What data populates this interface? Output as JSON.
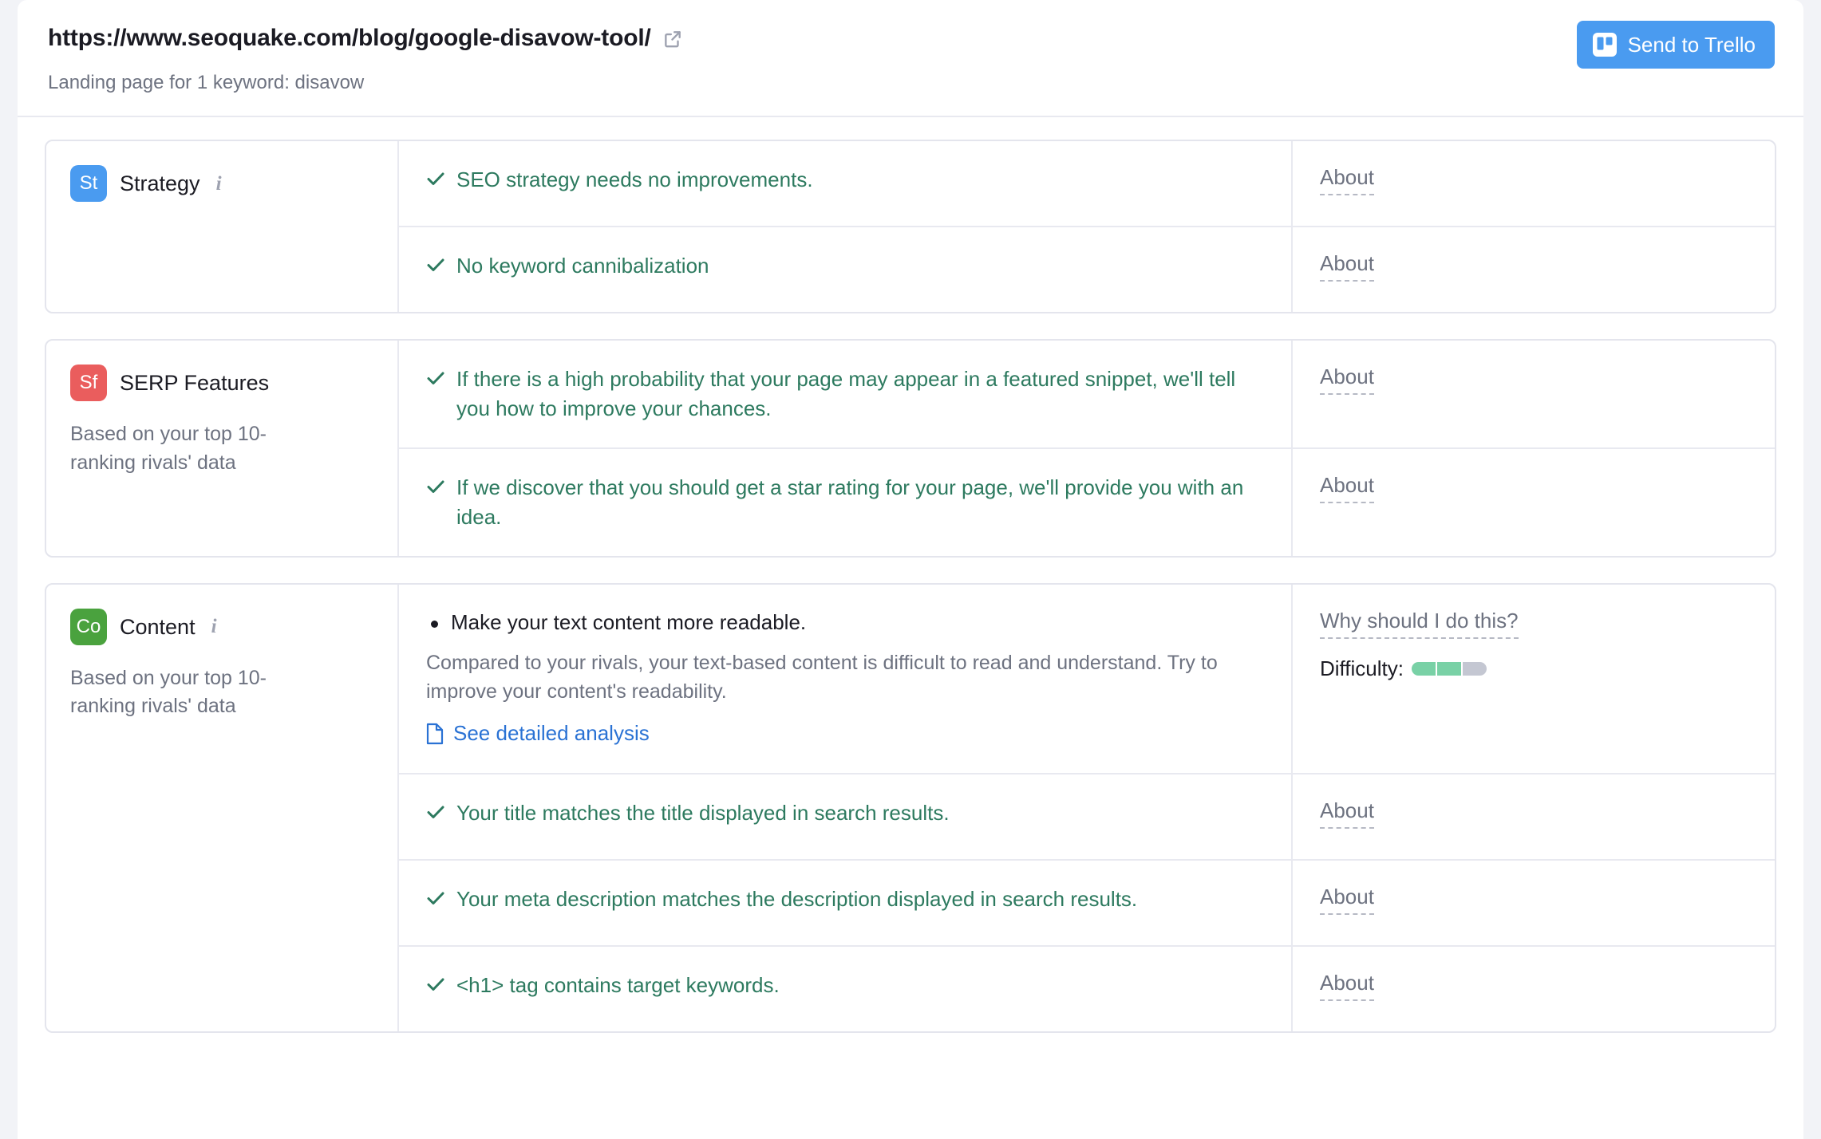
{
  "header": {
    "url": "https://www.seoquake.com/blog/google-disavow-tool/",
    "external_link_icon": "external-link-icon",
    "subtitle": "Landing page for 1 keyword: disavow",
    "trello_button_label": "Send to Trello",
    "trello_icon": "trello-icon",
    "trello_button_color": "#4a9bf0"
  },
  "labels": {
    "about": "About",
    "why": "Why should I do this?",
    "difficulty": "Difficulty:",
    "detail_link": "See detailed analysis"
  },
  "sections": [
    {
      "badge": "St",
      "badge_color": "#4a9bf0",
      "name": "Strategy",
      "has_info": true,
      "subtext": "",
      "rows": [
        {
          "type": "check",
          "text": "SEO strategy needs no improvements.",
          "side": "about"
        },
        {
          "type": "check",
          "text": "No keyword cannibalization",
          "side": "about"
        }
      ]
    },
    {
      "badge": "Sf",
      "badge_color": "#ea5d5d",
      "name": "SERP Features",
      "has_info": false,
      "subtext": "Based on your top 10-ranking rivals' data",
      "rows": [
        {
          "type": "check",
          "text": "If there is a high probability that your page may appear in a featured snippet, we'll tell you how to improve your chances.",
          "side": "about"
        },
        {
          "type": "check",
          "text": "If we discover that you should get a star rating for your page, we'll provide you with an idea.",
          "side": "about"
        }
      ]
    },
    {
      "badge": "Co",
      "badge_color": "#4aa23e",
      "name": "Content",
      "has_info": true,
      "subtext": "Based on your top 10-ranking rivals' data",
      "rows": [
        {
          "type": "issue",
          "title": "Make your text content more readable.",
          "description": "Compared to your rivals, your text-based content is difficult to read and understand. Try to improve your content's readability.",
          "link": "See detailed analysis",
          "side": "difficulty",
          "difficulty_filled": 2,
          "difficulty_total": 3
        },
        {
          "type": "check",
          "text": "Your title matches the title displayed in search results.",
          "side": "about"
        },
        {
          "type": "check",
          "text": "Your meta description matches the description displayed in search results.",
          "side": "about"
        },
        {
          "type": "check",
          "text": "<h1> tag contains target keywords.",
          "side": "about"
        }
      ]
    }
  ]
}
